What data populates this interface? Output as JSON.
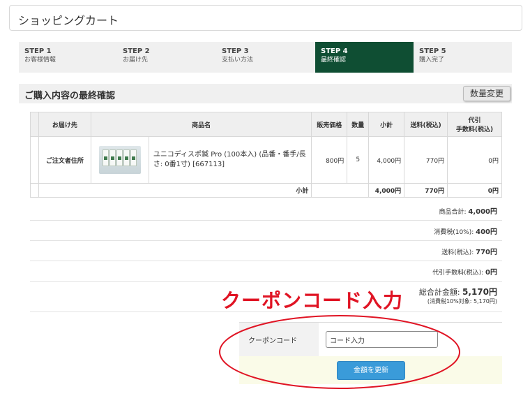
{
  "header": {
    "title": "ショッピングカート"
  },
  "steps": [
    {
      "num": "STEP 1",
      "name": "お客様情報"
    },
    {
      "num": "STEP 2",
      "name": "お届け先"
    },
    {
      "num": "STEP 3",
      "name": "支払い方法"
    },
    {
      "num": "STEP 4",
      "name": "最終確認"
    },
    {
      "num": "STEP 5",
      "name": "購入完了"
    }
  ],
  "active_step": 4,
  "colors": {
    "active_step_bg": "#0f4e33",
    "update_button": "#3a9bd9",
    "annotation": "#e01424"
  },
  "section": {
    "title": "ご購入内容の最終確認",
    "qty_change_button": "数量変更"
  },
  "table": {
    "headers": {
      "destination": "お届け先",
      "product": "商品名",
      "price": "販売価格",
      "qty": "数量",
      "subtotal": "小計",
      "shipping": "送料(税込)",
      "cod_line1": "代引",
      "cod_line2": "手数料(税込)"
    },
    "row": {
      "destination": "ご注文者住所",
      "product_image": "product-thumbnail",
      "product_name": "ユニコディスポ鍼 Pro (100本入) (品番・番手/長さ: 0番1寸) [667113]",
      "price": "800円",
      "qty": "5",
      "subtotal": "4,000円",
      "shipping": "770円",
      "cod": "0円"
    },
    "subtotal_row": {
      "label": "小計",
      "subtotal": "4,000円",
      "shipping": "770円",
      "cod": "0円"
    }
  },
  "summary": {
    "items_label": "商品合計: ",
    "items_value": "4,000円",
    "tax_label": "消費税(10%): ",
    "tax_value": "400円",
    "shipping_label": "送料(税込): ",
    "shipping_value": "770円",
    "cod_label": "代引手数料(税込): ",
    "cod_value": "0円",
    "total_label": "総合計金額: ",
    "total_value": "5,170円",
    "tax_note": "(消費税10%対象: 5,170円)"
  },
  "annotation": {
    "text": "クーポンコード入力"
  },
  "coupon": {
    "label": "クーポンコード",
    "value": "コード入力",
    "update_button": "金額を更新"
  }
}
